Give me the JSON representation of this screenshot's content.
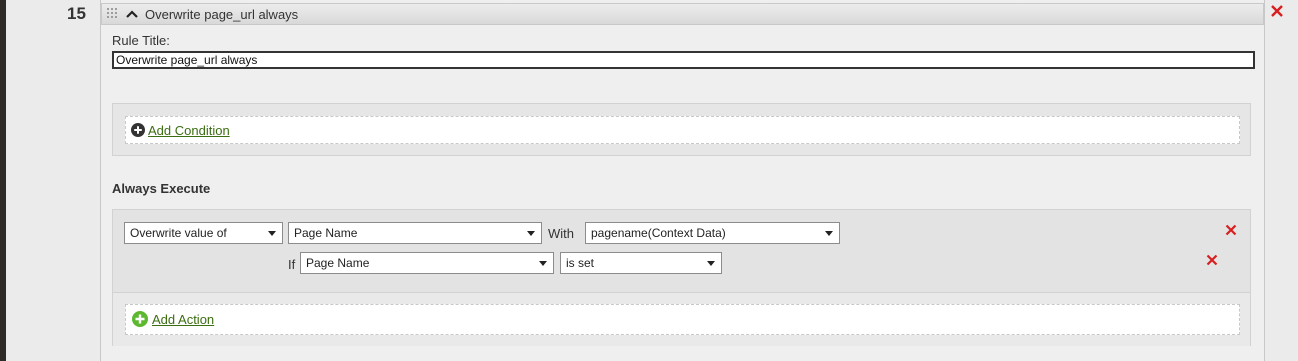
{
  "rule": {
    "number": "15",
    "header_title": "Overwrite page_url always",
    "title_label": "Rule Title:",
    "title_value": "Overwrite page_url always"
  },
  "conditions": {
    "add_label": "Add Condition"
  },
  "always_execute": {
    "heading": "Always Execute",
    "action_row": {
      "action_select": "Overwrite value of",
      "variable_select": "Page Name",
      "with_label": "With",
      "value_select": "pagename(Context Data)"
    },
    "if_row": {
      "if_label": "If",
      "variable_select": "Page Name",
      "operator_select": "is set"
    },
    "add_action_label": "Add Action"
  },
  "colors": {
    "delete_red": "#d81e1e",
    "link_green": "#3b6e12",
    "plus_green": "#5cb82e"
  }
}
